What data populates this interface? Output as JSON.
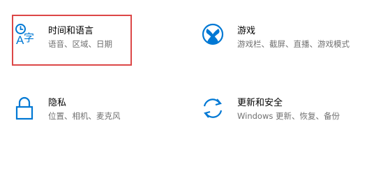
{
  "accent_color": "#0078d4",
  "highlight_color": "#dc4747",
  "tiles": [
    {
      "icon": "time-language-icon",
      "title": "时间和语言",
      "description": "语音、区域、日期"
    },
    {
      "icon": "xbox-icon",
      "title": "游戏",
      "description": "游戏栏、截屏、直播、游戏模式"
    },
    {
      "icon": "lock-icon",
      "title": "隐私",
      "description": "位置、相机、麦克风"
    },
    {
      "icon": "sync-icon",
      "title": "更新和安全",
      "description": "Windows 更新、恢复、备份"
    }
  ]
}
